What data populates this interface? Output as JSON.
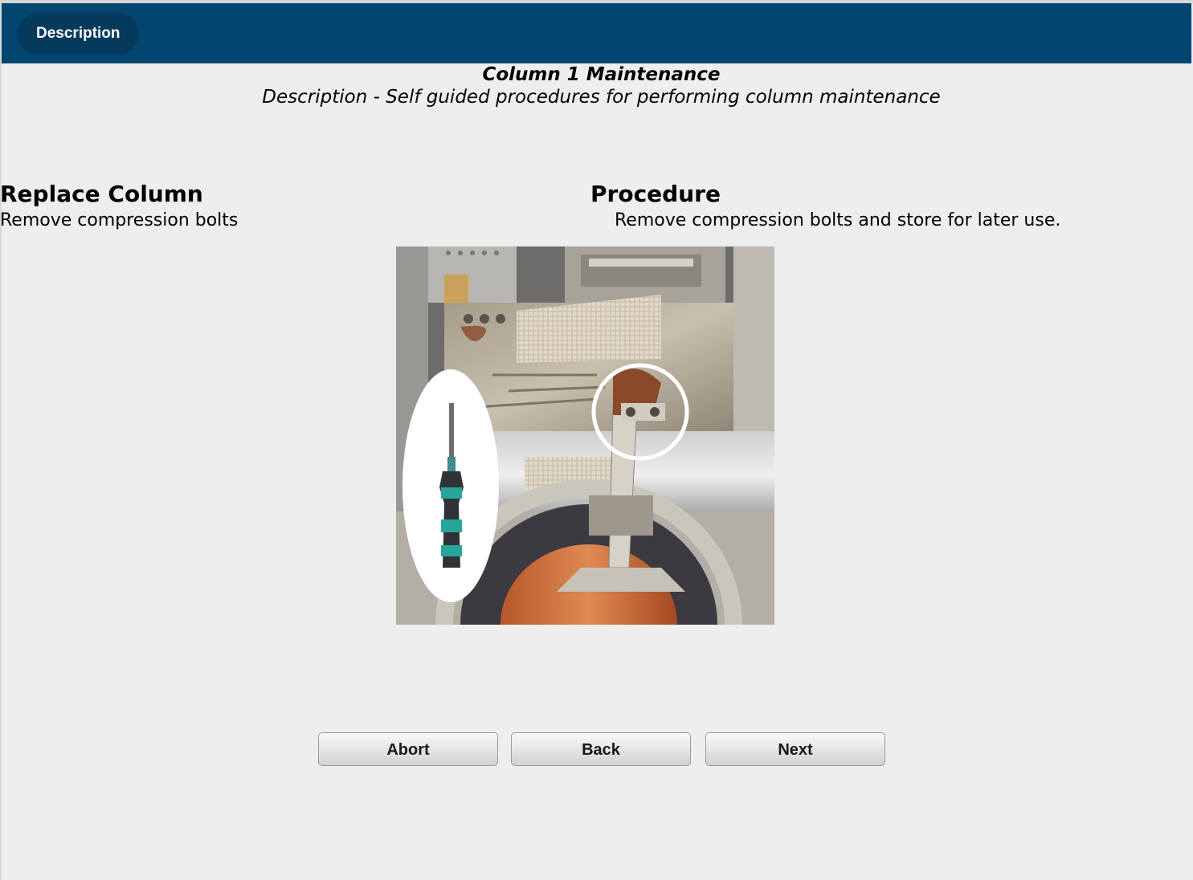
{
  "header": {
    "tab_label": "Description"
  },
  "page": {
    "title": "Column 1 Maintenance",
    "subtitle": "Description - Self guided procedures for performing column maintenance"
  },
  "step": {
    "heading": "Replace Column",
    "text": "Remove compression bolts"
  },
  "procedure": {
    "heading": "Procedure",
    "text": "Remove compression bolts and store for later use."
  },
  "buttons": {
    "abort": "Abort",
    "back": "Back",
    "next": "Next"
  }
}
